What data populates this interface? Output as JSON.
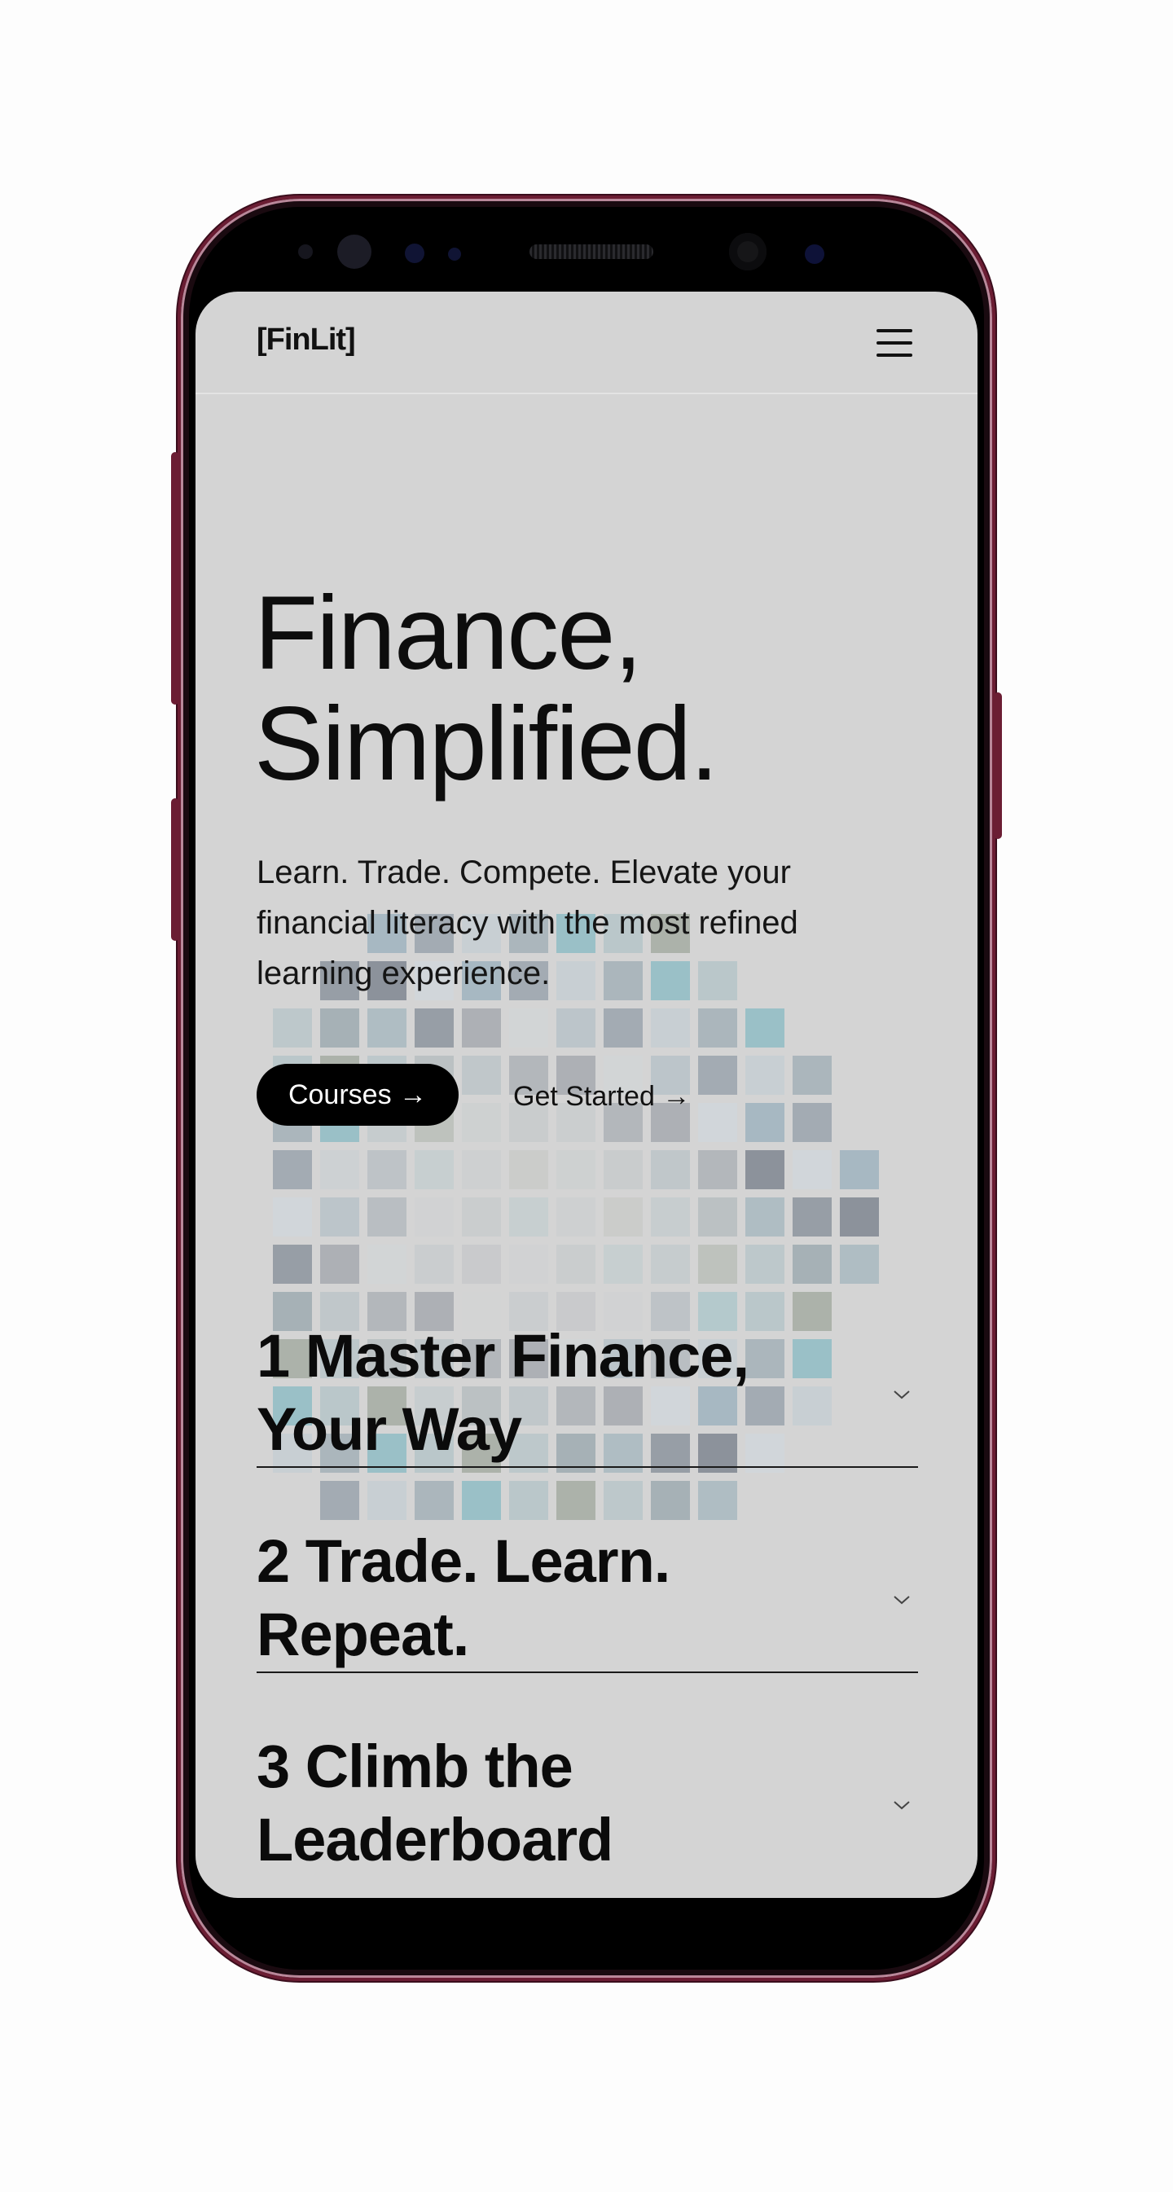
{
  "header": {
    "logo": "[FinLit]",
    "menu_icon": "hamburger-menu-icon"
  },
  "hero": {
    "title_line1": "Finance,",
    "title_line2": "Simplified.",
    "subtitle": "Learn. Trade. Compete. Elevate your financial literacy with the most refined learning experience.",
    "primary_button": "Courses →",
    "secondary_button": "Get Started →"
  },
  "features": [
    {
      "title": "1 Master Finance, Your Way",
      "icon": "chevron-down-icon"
    },
    {
      "title": "2 Trade. Learn. Repeat.",
      "icon": "chevron-down-icon"
    },
    {
      "title": "3 Climb the Leaderboard",
      "icon": "chevron-down-icon"
    }
  ],
  "colors": {
    "screen_background": "#d4d4d4",
    "phone_frame": "#6b1d33",
    "button_background": "#000000",
    "text": "#0d0d0d"
  }
}
